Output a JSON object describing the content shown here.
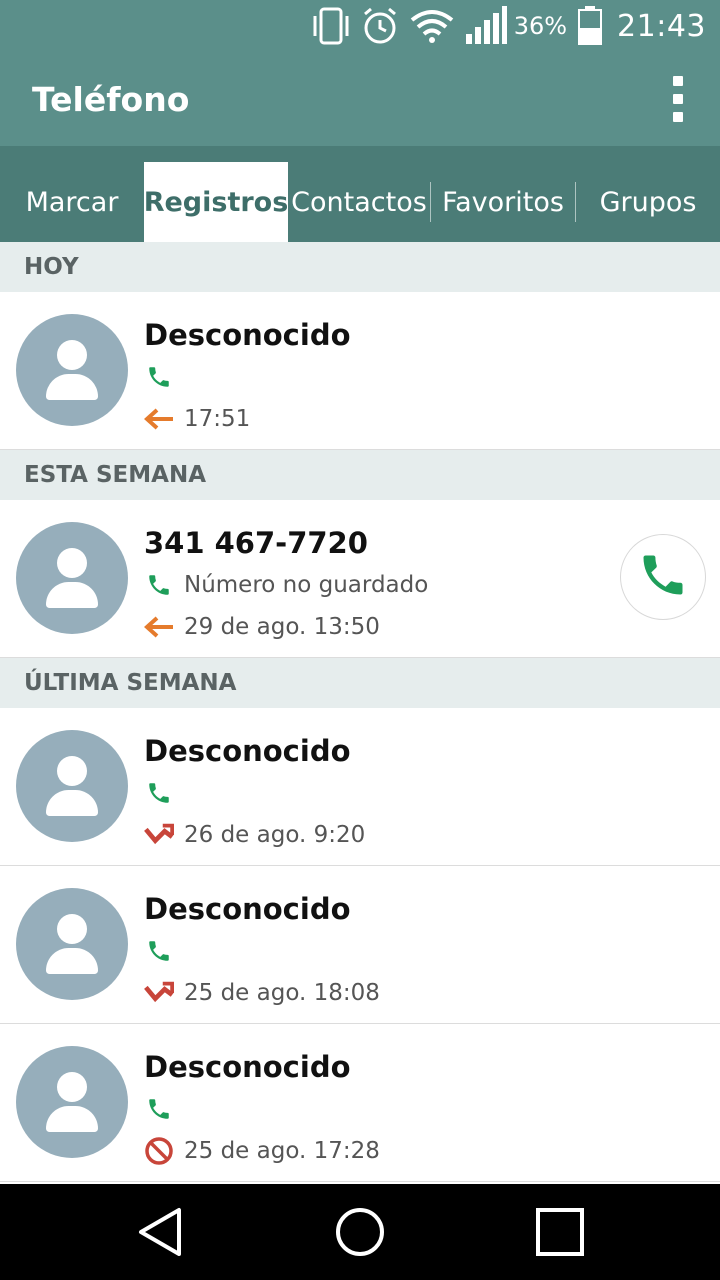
{
  "status_bar": {
    "battery_percent": "36%",
    "time": "21:43",
    "icons": [
      "vibrate-icon",
      "alarm-icon",
      "wifi-icon",
      "signal-icon",
      "battery-icon"
    ]
  },
  "app_bar": {
    "title": "Teléfono",
    "menu_icon": "more-vert-icon"
  },
  "tabs": [
    {
      "label": "Marcar",
      "active": false
    },
    {
      "label": "Registros",
      "active": true
    },
    {
      "label": "Contactos",
      "active": false
    },
    {
      "label": "Favoritos",
      "active": false
    },
    {
      "label": "Grupos",
      "active": false
    }
  ],
  "sections": [
    {
      "header": "HOY",
      "entries": [
        {
          "name": "Desconocido",
          "detail": "",
          "time": "17:51",
          "call_type": "outgoing"
        }
      ]
    },
    {
      "header": "ESTA SEMANA",
      "entries": [
        {
          "name": "341 467-7720",
          "detail": "Número no guardado",
          "time": "29 de ago. 13:50",
          "call_type": "outgoing"
        }
      ]
    },
    {
      "header": "ÚLTIMA SEMANA",
      "entries": [
        {
          "name": "Desconocido",
          "detail": "",
          "time": "26 de ago. 9:20",
          "call_type": "missed"
        },
        {
          "name": "Desconocido",
          "detail": "",
          "time": "25 de ago. 18:08",
          "call_type": "missed"
        },
        {
          "name": "Desconocido",
          "detail": "",
          "time": "25 de ago. 17:28",
          "call_type": "rejected"
        }
      ]
    }
  ],
  "colors": {
    "header_bg": "#5b8f8a",
    "tabs_bg": "#4b7c77",
    "phone_green": "#1e9e5a",
    "outgoing_orange": "#e57b2c",
    "missed_red": "#c8453a",
    "avatar_bg": "#96aebb"
  }
}
